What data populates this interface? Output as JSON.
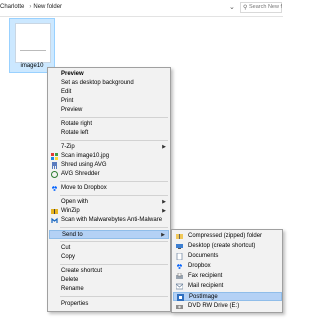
{
  "address": {
    "crumbs": [
      "Charlotte",
      "New folder"
    ],
    "search_placeholder": "Search New folder"
  },
  "file": {
    "name": "image10"
  },
  "menu": {
    "items": [
      {
        "label": "Preview",
        "bold": true
      },
      {
        "label": "Set as desktop background"
      },
      {
        "label": "Edit"
      },
      {
        "label": "Print"
      },
      {
        "label": "Preview"
      },
      {
        "label": "Rotate right"
      },
      {
        "label": "Rotate left"
      },
      {
        "label": "7-Zip"
      },
      {
        "label": "Scan image10.jpg"
      },
      {
        "label": "Shred using AVG"
      },
      {
        "label": "AVG Shredder"
      },
      {
        "label": "Move to Dropbox"
      },
      {
        "label": "Open with"
      },
      {
        "label": "WinZip"
      },
      {
        "label": "Scan with Malwarebytes Anti-Malware"
      },
      {
        "label": "Send to"
      },
      {
        "label": "Cut"
      },
      {
        "label": "Copy"
      },
      {
        "label": "Create shortcut"
      },
      {
        "label": "Delete"
      },
      {
        "label": "Rename"
      },
      {
        "label": "Properties"
      }
    ]
  },
  "send_to": {
    "items": [
      {
        "label": "Compressed (zipped) folder",
        "icon": "zip-folder-icon"
      },
      {
        "label": "Desktop (create shortcut)",
        "icon": "desktop-icon"
      },
      {
        "label": "Documents",
        "icon": "documents-icon"
      },
      {
        "label": "Dropbox",
        "icon": "dropbox-icon"
      },
      {
        "label": "Fax recipient",
        "icon": "fax-icon"
      },
      {
        "label": "Mail recipient",
        "icon": "mail-icon"
      },
      {
        "label": "PostImage",
        "icon": "postimage-icon"
      },
      {
        "label": "DVD RW Drive (E:)",
        "icon": "dvd-drive-icon"
      }
    ]
  },
  "colors": {
    "highlight": "#b4d1f5",
    "selection": "#cce8ff"
  }
}
